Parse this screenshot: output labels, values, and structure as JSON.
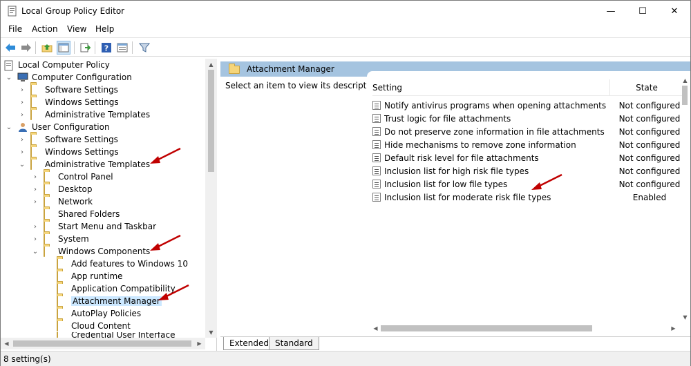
{
  "window": {
    "title": "Local Group Policy Editor",
    "controls": {
      "minimize": "—",
      "maximize": "☐",
      "close": "✕"
    }
  },
  "menu": [
    "File",
    "Action",
    "View",
    "Help"
  ],
  "toolbar": {
    "buttons": [
      "back-icon",
      "forward-icon",
      "up-folder-icon",
      "show-hide-tree-icon",
      "export-list-icon",
      "help-icon",
      "properties-icon",
      "filter-icon"
    ]
  },
  "tree": {
    "root": "Local Computer Policy",
    "computer_config": "Computer Configuration",
    "cc_software": "Software Settings",
    "cc_windows": "Windows Settings",
    "cc_admin": "Administrative Templates",
    "user_config": "User Configuration",
    "uc_software": "Software Settings",
    "uc_windows": "Windows Settings",
    "uc_admin": "Administrative Templates",
    "control_panel": "Control Panel",
    "desktop": "Desktop",
    "network": "Network",
    "shared_folders": "Shared Folders",
    "start_menu": "Start Menu and Taskbar",
    "system": "System",
    "windows_components": "Windows Components",
    "add_features": "Add features to Windows 10",
    "app_runtime": "App runtime",
    "app_compat": "Application Compatibility",
    "attachment_manager": "Attachment Manager",
    "autoplay": "AutoPlay Policies",
    "cloud_content": "Cloud Content",
    "partial_next": "Credential User Interface"
  },
  "right": {
    "header": "Attachment Manager",
    "description": "Select an item to view its description.",
    "columns": {
      "setting": "Setting",
      "state": "State"
    },
    "settings": [
      {
        "name": "Notify antivirus programs when opening attachments",
        "state": "Not configured"
      },
      {
        "name": "Trust logic for file attachments",
        "state": "Not configured"
      },
      {
        "name": "Do not preserve zone information in file attachments",
        "state": "Not configured"
      },
      {
        "name": "Hide mechanisms to remove zone information",
        "state": "Not configured"
      },
      {
        "name": "Default risk level for file attachments",
        "state": "Not configured"
      },
      {
        "name": "Inclusion list for high risk file types",
        "state": "Not configured"
      },
      {
        "name": "Inclusion list for low file types",
        "state": "Not configured"
      },
      {
        "name": "Inclusion list for moderate risk file types",
        "state": "Enabled"
      }
    ]
  },
  "tabs": [
    "Extended",
    "Standard"
  ],
  "status": "8 setting(s)",
  "colors": {
    "header_bg": "#a5c4e0",
    "selected_bg": "#cce8ff",
    "arrow": "#c00000"
  }
}
